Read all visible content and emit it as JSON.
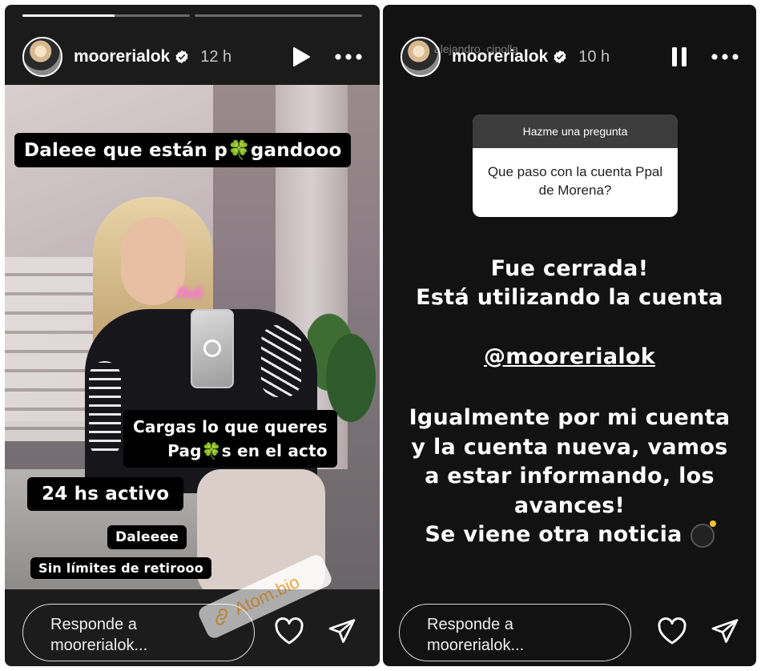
{
  "left_story": {
    "progress": [
      0.55,
      0
    ],
    "username": "moorerialok",
    "time": "12 h",
    "captions": {
      "line1": "Daleee que están p🍀gandooo",
      "line2a": "Cargas lo que queres",
      "line2b": "Pag🍀s en el acto",
      "line3": "24 hs activo",
      "line4": "Daleeee",
      "line5": "Sin límites de retirooo"
    },
    "neon_sign": "Ruli",
    "watermark": "Atom.bio",
    "reply_line1": "Responde a",
    "reply_line2": "moorerialok..."
  },
  "right_story": {
    "username": "moorerialok",
    "sub_author": "alejandro_cipolla",
    "time": "10 h",
    "question_header": "Hazme una pregunta",
    "question": "Que paso con la cuenta Ppal de Morena?",
    "lines": {
      "l1": "Fue cerrada!",
      "l2": "Está utilizando la cuenta",
      "l3": "@moorerialok",
      "l4": "Igualmente por mi cuenta",
      "l5": "y la cuenta nueva, vamos",
      "l6": "a estar informando, los",
      "l7": "avances!",
      "l8": "Se viene otra noticia"
    },
    "reply_line1": "Responde a",
    "reply_line2": "moorerialok..."
  },
  "colors": {
    "verified": "#ffffff",
    "caption_bg": "#000000",
    "watermark_text": "#f2a33c"
  },
  "icons": [
    "play-icon",
    "more-icon",
    "pause-icon",
    "verified-icon",
    "heart-icon",
    "send-icon",
    "link-icon",
    "bomb-icon"
  ]
}
